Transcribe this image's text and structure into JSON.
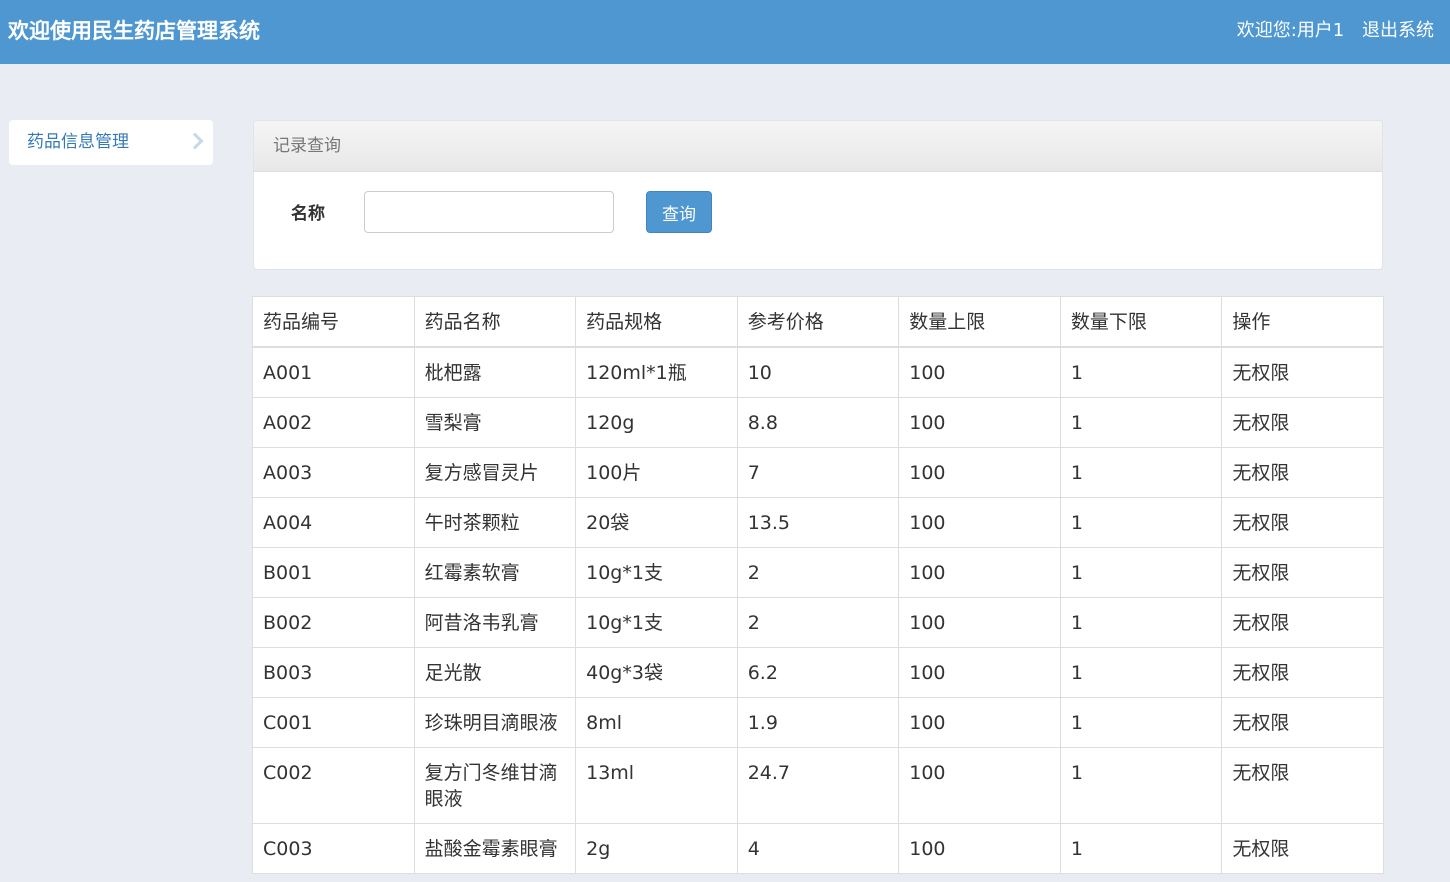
{
  "header": {
    "title": "欢迎使用民生药店管理系统",
    "welcome": "欢迎您:",
    "username": "用户1",
    "logout": "退出系统"
  },
  "sidebar": {
    "items": [
      {
        "label": "药品信息管理"
      }
    ]
  },
  "search_panel": {
    "title": "记录查询",
    "name_label": "名称",
    "name_value": "",
    "query_button": "查询"
  },
  "table": {
    "columns": [
      "药品编号",
      "药品名称",
      "药品规格",
      "参考价格",
      "数量上限",
      "数量下限",
      "操作"
    ],
    "rows": [
      [
        "A001",
        "枇杷露",
        "120ml*1瓶",
        "10",
        "100",
        "1",
        "无权限"
      ],
      [
        "A002",
        "雪梨膏",
        "120g",
        "8.8",
        "100",
        "1",
        "无权限"
      ],
      [
        "A003",
        "复方感冒灵片",
        "100片",
        "7",
        "100",
        "1",
        "无权限"
      ],
      [
        "A004",
        "午时茶颗粒",
        "20袋",
        "13.5",
        "100",
        "1",
        "无权限"
      ],
      [
        "B001",
        "红霉素软膏",
        "10g*1支",
        "2",
        "100",
        "1",
        "无权限"
      ],
      [
        "B002",
        "阿昔洛韦乳膏",
        "10g*1支",
        "2",
        "100",
        "1",
        "无权限"
      ],
      [
        "B003",
        "足光散",
        "40g*3袋",
        "6.2",
        "100",
        "1",
        "无权限"
      ],
      [
        "C001",
        "珍珠明目滴眼液",
        "8ml",
        "1.9",
        "100",
        "1",
        "无权限"
      ],
      [
        "C002",
        "复方门冬维甘滴眼液",
        "13ml",
        "24.7",
        "100",
        "1",
        "无权限"
      ],
      [
        "C003",
        "盐酸金霉素眼膏",
        "2g",
        "4",
        "100",
        "1",
        "无权限"
      ]
    ]
  },
  "colors": {
    "header_bg": "#4e97d1",
    "page_bg": "#e9ecf3",
    "link": "#337ab7"
  }
}
